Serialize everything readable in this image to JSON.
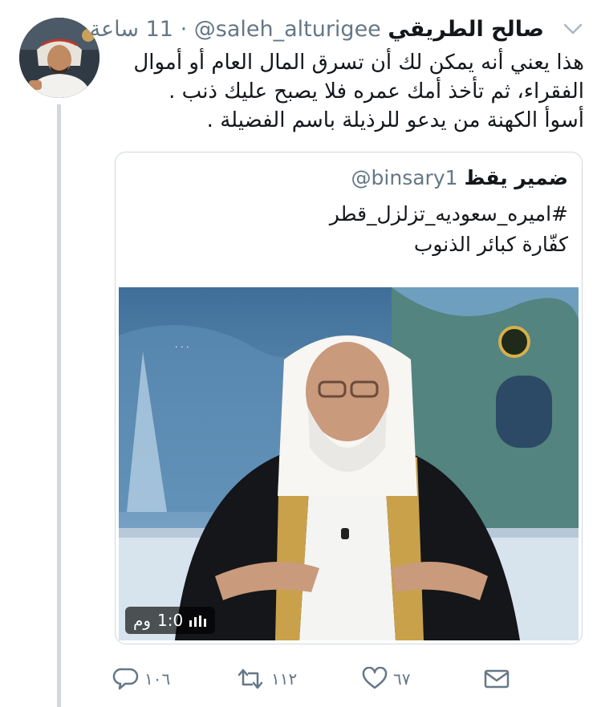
{
  "tweet": {
    "author_name": "صالح الطريقي",
    "author_handle": "@saleh_alturigee",
    "separator": "·",
    "time": "11 ساعة",
    "text": "هذا يعني أنه يمكن لك أن تسرق المال العام أو أموال الفقراء، ثم تأخذ أمك عمره فلا يصبح عليك ذنب .\nأسوأ الكهنة من يدعو للرذيلة باسم الفضيلة ."
  },
  "quoted": {
    "author_name": "ضمير يقظ",
    "author_handle": "@binsary1",
    "text": "#اميره_سعوديه_تزلزل_قطر\nكفّارة كبائر الذنوب",
    "video_duration": "1:0",
    "video_views": "وم"
  },
  "actions": {
    "reply_count": "١٠٦",
    "retweet_count": "١١٢",
    "like_count": "٦٧"
  },
  "icons": {
    "chevron": "chevron-down-icon",
    "reply": "reply-icon",
    "retweet": "retweet-icon",
    "like": "heart-icon",
    "dm": "envelope-icon",
    "video": "video-icon"
  },
  "colors": {
    "text": "#14171a",
    "secondary": "#657786",
    "border": "#cfd9de"
  }
}
